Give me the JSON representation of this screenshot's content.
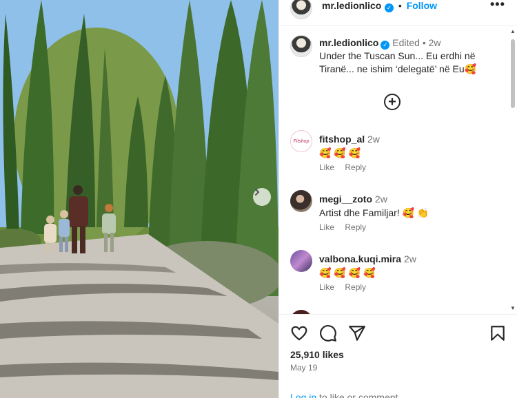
{
  "post": {
    "username": "mr.ledionlico",
    "follow_label": "Follow",
    "separator": "•",
    "caption_meta": "Edited • 2w",
    "caption_text": "Under the Tuscan Sun... Eu erdhi në Tiranë... ne ishim ‘delegatë’ në Eu🥰",
    "likes": "25,910 likes",
    "date": "May 19",
    "login_link": "Log in",
    "login_rest": " to like or comment."
  },
  "comments": [
    {
      "username": "fitshop_al",
      "time": "2w",
      "text": "🥰 🥰 🥰",
      "like": "Like",
      "reply": "Reply",
      "avatar_text": "Fitshop"
    },
    {
      "username": "megi__zoto",
      "time": "2w",
      "text": "Artist dhe Familjar! 🥰 👏",
      "like": "Like",
      "reply": "Reply"
    },
    {
      "username": "valbona.kuqi.mira",
      "time": "2w",
      "text": "🥰 🥰 🥰 🥰",
      "like": "Like",
      "reply": "Reply"
    }
  ],
  "icons": [
    "more-options-icon",
    "verified-icon",
    "add-comments-icon",
    "like-icon",
    "comment-icon",
    "share-icon",
    "save-icon",
    "next-slide-icon"
  ]
}
